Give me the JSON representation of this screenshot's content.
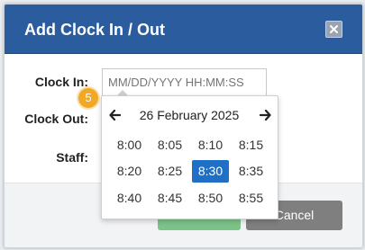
{
  "dialog": {
    "title": "Add Clock In / Out",
    "close_icon": "close-x-icon"
  },
  "form": {
    "clock_in_label": "Clock In:",
    "clock_in_placeholder": "MM/DD/YYYY HH:MM:SS",
    "clock_in_value": "",
    "clock_out_label": "Clock Out:",
    "staff_label": "Staff:"
  },
  "buttons": {
    "save_label": "",
    "cancel_label": "Cancel"
  },
  "picker": {
    "date_label": "26 February 2025",
    "prev_icon": "arrow-left-icon",
    "next_icon": "arrow-right-icon",
    "times": [
      "8:00",
      "8:05",
      "8:10",
      "8:15",
      "8:20",
      "8:25",
      "8:30",
      "8:35",
      "8:40",
      "8:45",
      "8:50",
      "8:55"
    ],
    "selected_time": "8:30"
  },
  "badge": {
    "value": "5"
  },
  "colors": {
    "header": "#2b5c9e",
    "selected": "#1f6fc6",
    "badge": "#f0a826",
    "save": "#7cc38a",
    "cancel": "#7f7f7f"
  }
}
